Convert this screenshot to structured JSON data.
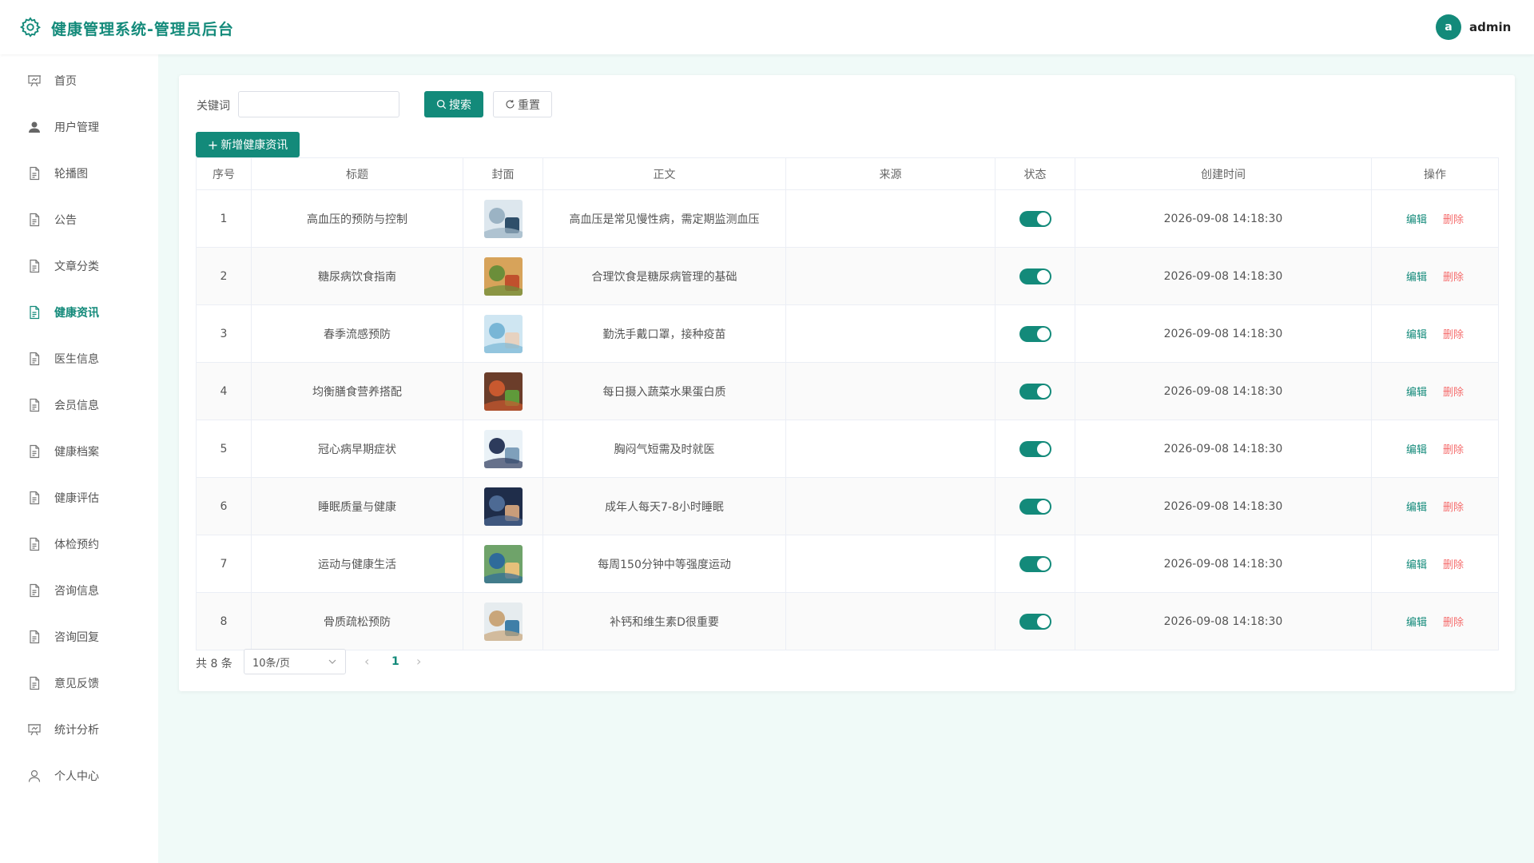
{
  "header": {
    "title": "健康管理系统-管理员后台",
    "avatar_letter": "a",
    "user": "admin"
  },
  "sidebar": {
    "items": [
      {
        "label": "首页",
        "icon": "presentation-icon"
      },
      {
        "label": "用户管理",
        "icon": "user-icon"
      },
      {
        "label": "轮播图",
        "icon": "document-icon"
      },
      {
        "label": "公告",
        "icon": "document-icon"
      },
      {
        "label": "文章分类",
        "icon": "document-icon"
      },
      {
        "label": "健康资讯",
        "icon": "document-icon",
        "active": true
      },
      {
        "label": "医生信息",
        "icon": "document-icon"
      },
      {
        "label": "会员信息",
        "icon": "document-icon"
      },
      {
        "label": "健康档案",
        "icon": "document-icon"
      },
      {
        "label": "健康评估",
        "icon": "document-icon"
      },
      {
        "label": "体检预约",
        "icon": "document-icon"
      },
      {
        "label": "咨询信息",
        "icon": "document-icon"
      },
      {
        "label": "咨询回复",
        "icon": "document-icon"
      },
      {
        "label": "意见反馈",
        "icon": "document-icon"
      },
      {
        "label": "统计分析",
        "icon": "presentation-icon"
      },
      {
        "label": "个人中心",
        "icon": "user-outline-icon"
      }
    ]
  },
  "search": {
    "label": "关键词",
    "value": "",
    "placeholder": "",
    "search_btn": "搜索",
    "reset_btn": "重置"
  },
  "add_btn": "新增健康资讯",
  "table": {
    "headers": [
      "序号",
      "标题",
      "封面",
      "正文",
      "来源",
      "状态",
      "创建时间",
      "操作"
    ],
    "rows": [
      {
        "no": "1",
        "title": "高血压的预防与控制",
        "body": "高血压是常见慢性病，需定期监测血压",
        "source": "",
        "status": true,
        "created": "2026-09-08 14:18:30"
      },
      {
        "no": "2",
        "title": "糖尿病饮食指南",
        "body": "合理饮食是糖尿病管理的基础",
        "source": "",
        "status": true,
        "created": "2026-09-08 14:18:30"
      },
      {
        "no": "3",
        "title": "春季流感预防",
        "body": "勤洗手戴口罩，接种疫苗",
        "source": "",
        "status": true,
        "created": "2026-09-08 14:18:30"
      },
      {
        "no": "4",
        "title": "均衡膳食营养搭配",
        "body": "每日摄入蔬菜水果蛋白质",
        "source": "",
        "status": true,
        "created": "2026-09-08 14:18:30"
      },
      {
        "no": "5",
        "title": "冠心病早期症状",
        "body": "胸闷气短需及时就医",
        "source": "",
        "status": true,
        "created": "2026-09-08 14:18:30"
      },
      {
        "no": "6",
        "title": "睡眠质量与健康",
        "body": "成年人每天7-8小时睡眠",
        "source": "",
        "status": true,
        "created": "2026-09-08 14:18:30"
      },
      {
        "no": "7",
        "title": "运动与健康生活",
        "body": "每周150分钟中等强度运动",
        "source": "",
        "status": true,
        "created": "2026-09-08 14:18:30"
      },
      {
        "no": "8",
        "title": "骨质疏松预防",
        "body": "补钙和维生素D很重要",
        "source": "",
        "status": true,
        "created": "2026-09-08 14:18:30"
      }
    ],
    "edit_label": "编辑",
    "delete_label": "删除"
  },
  "pagination": {
    "total": "共 8 条",
    "page_size": "10条/页",
    "current_page": "1"
  },
  "colors": {
    "primary": "#138a7a",
    "danger": "#f56c6c",
    "bg": "#f0faf8"
  }
}
